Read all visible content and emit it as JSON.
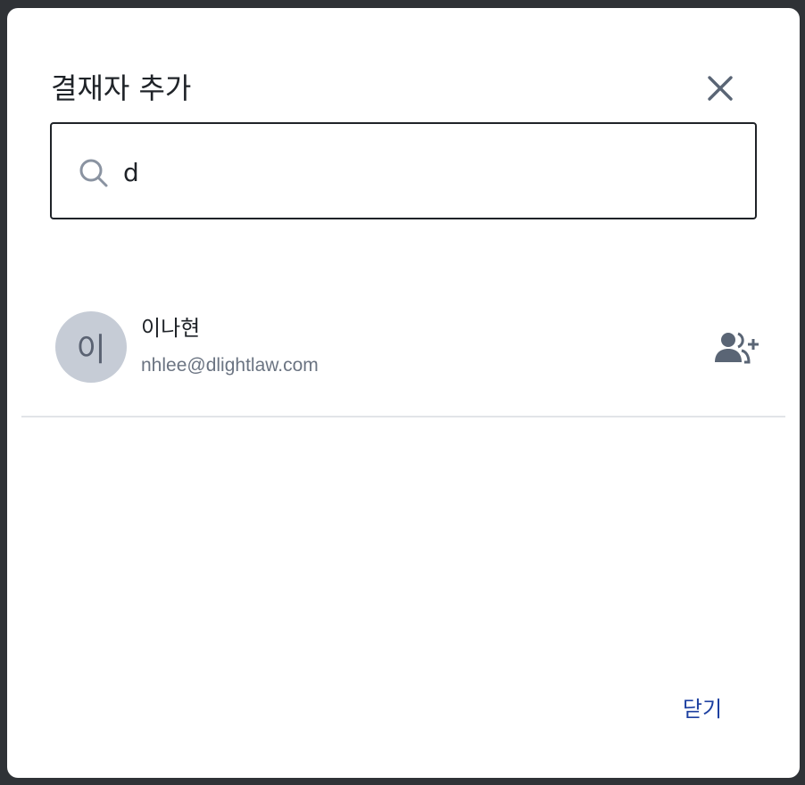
{
  "dialog": {
    "title": "결재자 추가",
    "close_icon": "close-icon"
  },
  "search": {
    "value": "d",
    "icon": "search-icon"
  },
  "results": [
    {
      "avatar_initial": "이",
      "name": "이나현",
      "email": "nhlee@dlightlaw.com",
      "action_icon": "add-user-icon"
    }
  ],
  "footer": {
    "close_label": "닫기"
  },
  "colors": {
    "accent": "#1c3fa0",
    "avatar_bg": "#c6ccd6",
    "icon": "#5a6575",
    "divider": "#e2e4e8"
  }
}
